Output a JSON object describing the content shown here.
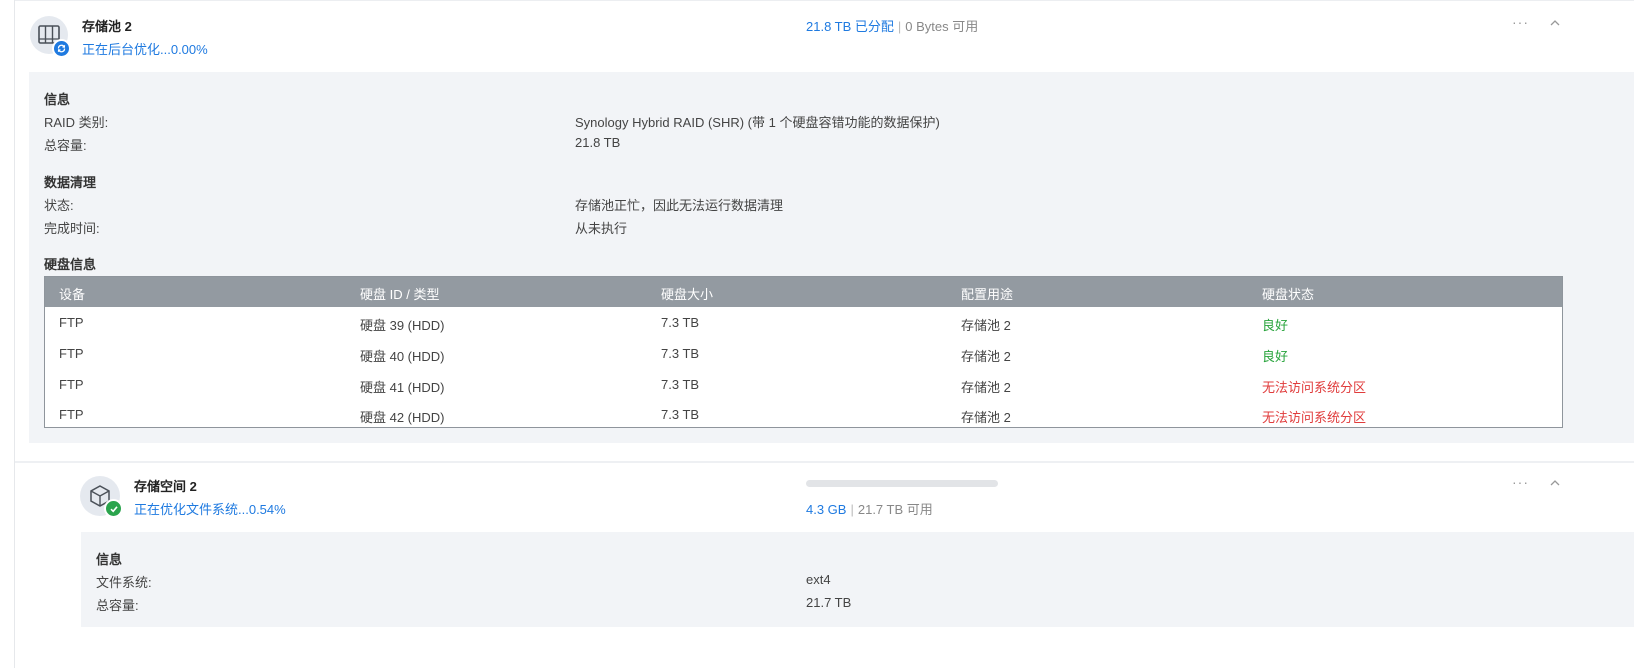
{
  "pool": {
    "title": "存储池 2",
    "status": "正在后台优化...0.00%",
    "allocated": "21.8 TB 已分配",
    "available": "0 Bytes 可用",
    "more": "···",
    "collapse": "^",
    "info_heading": "信息",
    "raid_label": "RAID 类别:",
    "raid_value": "Synology Hybrid RAID (SHR) (带 1 个硬盘容错功能的数据保护)",
    "capacity_label": "总容量:",
    "capacity_value": "21.8 TB",
    "scrub_heading": "数据清理",
    "scrub_status_label": "状态:",
    "scrub_status_value": "存储池正忙，因此无法运行数据清理",
    "scrub_time_label": "完成时间:",
    "scrub_time_value": "从未执行",
    "disk_heading": "硬盘信息",
    "columns": [
      "设备",
      "硬盘 ID / 类型",
      "硬盘大小",
      "配置用途",
      "硬盘状态"
    ],
    "disks": [
      {
        "device": "FTP",
        "id": "硬盘 39 (HDD)",
        "size": "7.3 TB",
        "usage": "存储池 2",
        "status": "良好"
      },
      {
        "device": "FTP",
        "id": "硬盘 40 (HDD)",
        "size": "7.3 TB",
        "usage": "存储池 2",
        "status": "良好"
      },
      {
        "device": "FTP",
        "id": "硬盘 41 (HDD)",
        "size": "7.3 TB",
        "usage": "存储池 2",
        "status": "无法访问系统分区"
      },
      {
        "device": "FTP",
        "id": "硬盘 42 (HDD)",
        "size": "7.3 TB",
        "usage": "存储池 2",
        "status": "无法访问系统分区"
      }
    ]
  },
  "volume": {
    "title": "存储空间 2",
    "status": "正在优化文件系统...0.54%",
    "used": "4.3 GB",
    "available": "21.7 TB 可用",
    "usage_fraction": 0.0002,
    "more": "···",
    "collapse": "^",
    "info_heading": "信息",
    "fs_label": "文件系统:",
    "fs_value": "ext4",
    "capacity_label": "总容量:",
    "capacity_value": "21.7 TB"
  },
  "colors": {
    "accent": "#1f7ae0",
    "good": "#27a33b",
    "error": "#e03b3b"
  },
  "icons": [
    "storage-pool-icon",
    "sync-icon",
    "volume-cube-icon",
    "check-icon",
    "more-icon",
    "chevron-up-icon"
  ]
}
